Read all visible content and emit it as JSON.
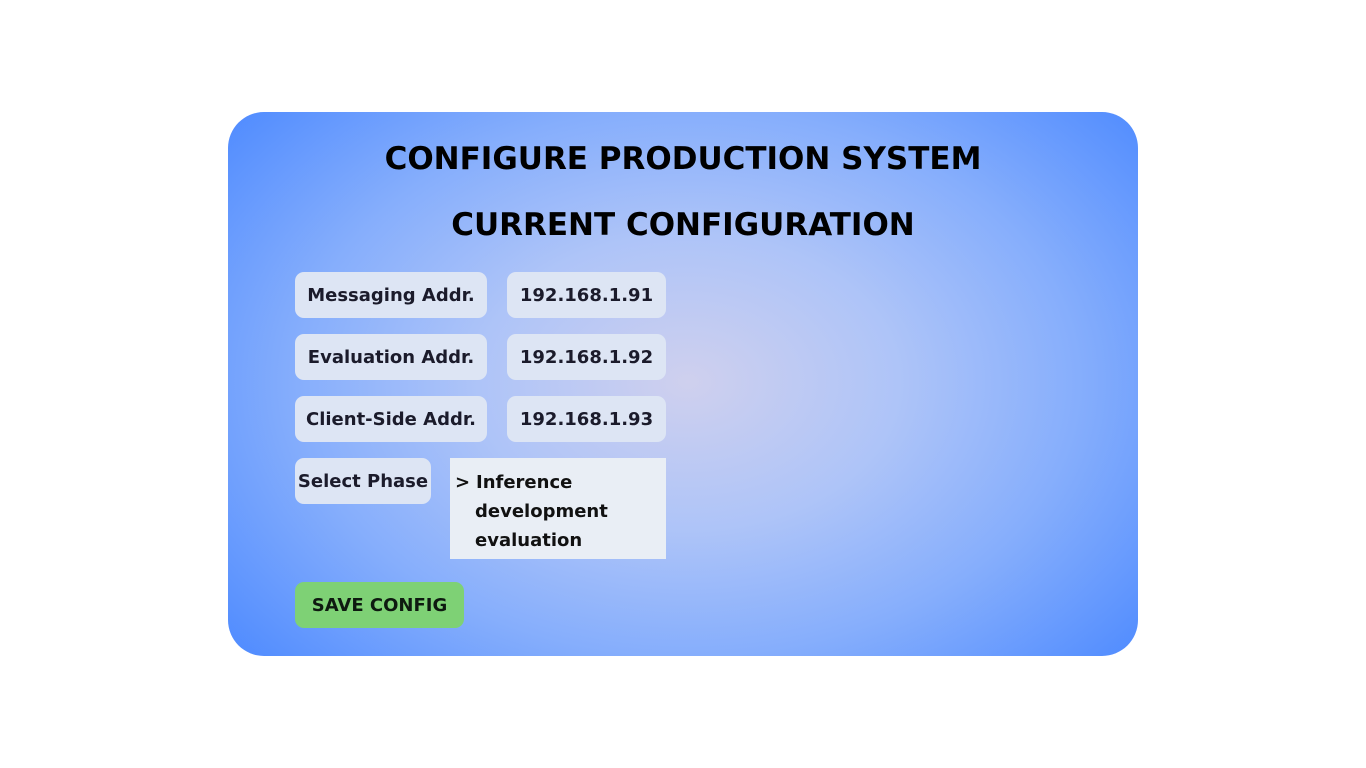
{
  "header": {
    "title": "CONFIGURE PRODUCTION SYSTEM",
    "subtitle": "CURRENT CONFIGURATION"
  },
  "config": {
    "rows": [
      {
        "label": "Messaging Addr.",
        "value": "192.168.1.91"
      },
      {
        "label": "Evaluation Addr.",
        "value": "192.168.1.92"
      },
      {
        "label": "Client-Side Addr.",
        "value": "192.168.1.93"
      }
    ]
  },
  "phase": {
    "label": "Select Phase",
    "selected_marker": ">",
    "options": [
      "Inference",
      "development",
      "evaluation"
    ],
    "selected": "Inference"
  },
  "actions": {
    "save_label": "SAVE CONFIG",
    "save_color": "#7ed175"
  },
  "colors": {
    "panel_edge": "#4f8bff",
    "panel_center": "#cfd0ee"
  }
}
